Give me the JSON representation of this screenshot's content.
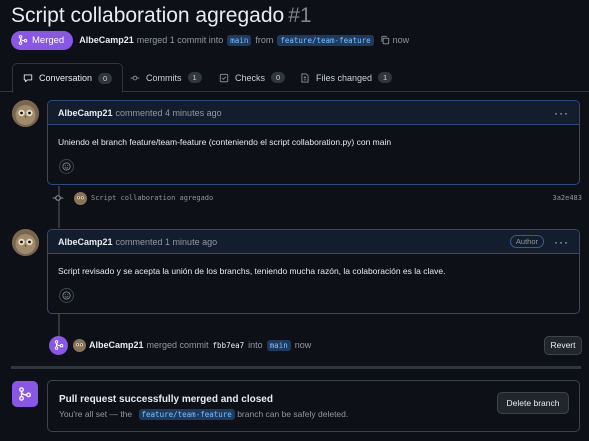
{
  "pr": {
    "title": "Script collaboration agregado",
    "number": "#1",
    "status": "Merged",
    "author": "AlbeCamp21",
    "summary_mid": "merged 1 commit into",
    "base_branch": "main",
    "from_text": "from",
    "head_branch": "feature/team-feature",
    "time": "now"
  },
  "tabs": [
    {
      "label": "Conversation",
      "count": "0"
    },
    {
      "label": "Commits",
      "count": "1"
    },
    {
      "label": "Checks",
      "count": "0"
    },
    {
      "label": "Files changed",
      "count": "1"
    }
  ],
  "comments": [
    {
      "author": "AlbeCamp21",
      "meta": "commented 4 minutes ago",
      "role": "",
      "body": "Uniendo el branch feature/team-feature (conteniendo el script collaboration.py) con main"
    },
    {
      "author": "AlbeCamp21",
      "meta": "commented 1 minute ago",
      "role": "Author",
      "body": "Script revisado y se acepta la unión de los branchs, teniendo mucha razón, la colaboración es la clave."
    }
  ],
  "commit": {
    "message": "Script collaboration agregado",
    "sha": "3a2e483"
  },
  "merge_event": {
    "user": "AlbeCamp21",
    "text1": "merged commit",
    "sha": "fbb7ea7",
    "text2": "into",
    "branch": "main",
    "time": "now",
    "revert_label": "Revert"
  },
  "merged_box": {
    "title": "Pull request successfully merged and closed",
    "text_before": "You're all set — the",
    "branch": "feature/team-feature",
    "text_after": "branch can be safely deleted.",
    "delete_label": "Delete branch"
  },
  "colors": {
    "merged_purple": "#8957e5",
    "background": "#0d1117",
    "comment_border": "#2f4b7a"
  }
}
